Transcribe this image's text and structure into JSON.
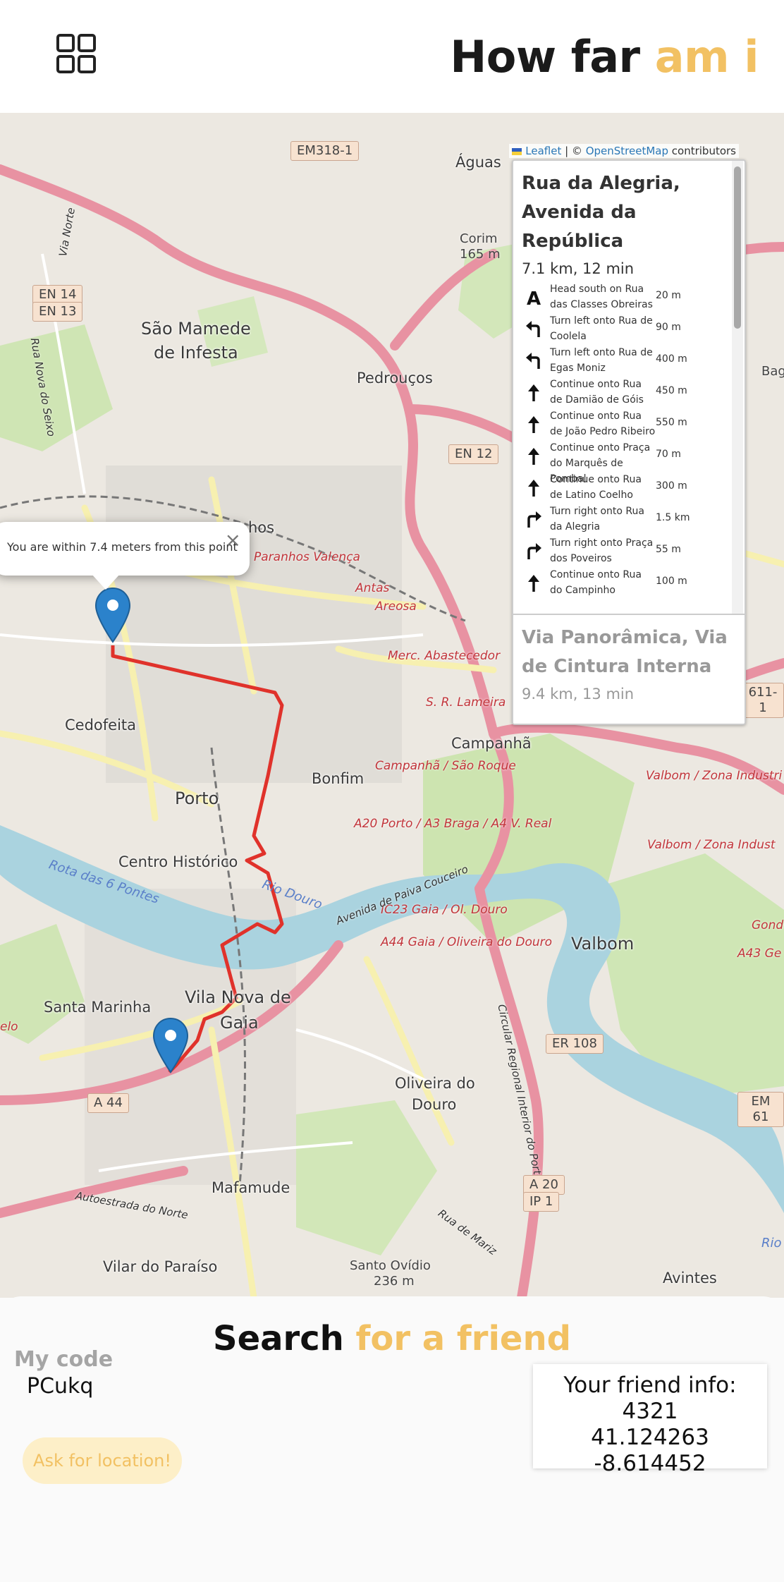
{
  "header": {
    "title_main": "How far ",
    "title_accent": "am i",
    "menu_icon": "grid-icon"
  },
  "map": {
    "attribution": {
      "leaflet": "Leaflet",
      "separator": " | © ",
      "osm": "OpenStreetMap",
      "contributors": " contributors"
    },
    "popup": {
      "text": "You are within 7.4 meters from this point",
      "close": "×"
    },
    "places": [
      "Águas",
      "São Mamede",
      "de Infesta",
      "Pedrouços",
      "Corim",
      "165 m",
      "Cedofeita",
      "Porto",
      "Bonfim",
      "Campanhã",
      "Centro Histórico",
      "Santa Marinha",
      "Vila Nova de",
      "Gaia",
      "Oliveira do",
      "Douro",
      "Valbom",
      "Mafamude",
      "Vilar do Paraíso",
      "Santo Ovídio",
      "236 m",
      "Avintes",
      "Paranhos",
      "hos",
      "Bag",
      "Valbom / Zona Industri",
      "Valbom / Zona Indust",
      "Gondom",
      "A43 Ge",
      "Rio",
      "elo"
    ],
    "road_labels": [
      "Paranhos Valença",
      "Antas",
      "Areosa",
      "Merc. Abastecedor",
      "S. R. Lameira",
      "Campanhã / São Roque",
      "A20 Porto / A3 Braga / A4 V. Real",
      "IC23 Gaia / Ol. Douro",
      "A44 Gaia / Oliveira do Douro",
      "Avenida de Paiva Couceiro",
      "Circular Regional Interior do Porto",
      "Autoestrada do Norte",
      "Rua de Mariz",
      "Via Norte",
      "Rua Nova do Seixo"
    ],
    "water_labels": [
      "Rota das 6 Pontes",
      "Rio Douro"
    ],
    "shields": [
      "EM318-1",
      "EN 14",
      "EN 13",
      "EN 12",
      "ER 108",
      "A 44",
      "A 20",
      "IP 1",
      "611-1",
      "EM 61"
    ]
  },
  "routing": {
    "active": {
      "title": "Rua da Alegria, Avenida da República",
      "summary": "7.1 km, 12 min",
      "steps": [
        {
          "icon": "depart-icon",
          "text": "Head south on Rua das Classes Obreiras",
          "distance": "20 m"
        },
        {
          "icon": "turn-left-icon",
          "text": "Turn left onto Rua de Coolela",
          "distance": "90 m"
        },
        {
          "icon": "turn-left-icon",
          "text": "Turn left onto Rua de Egas Moniz",
          "distance": "400 m"
        },
        {
          "icon": "straight-icon",
          "text": "Continue onto Rua de Damião de Góis",
          "distance": "450 m"
        },
        {
          "icon": "straight-icon",
          "text": "Continue onto Rua de João Pedro Ribeiro",
          "distance": "550 m"
        },
        {
          "icon": "straight-icon",
          "text": "Continue onto Praça do Marquês de Pombal",
          "distance": "70 m"
        },
        {
          "icon": "straight-icon",
          "text": "Continue onto Rua de Latino Coelho",
          "distance": "300 m"
        },
        {
          "icon": "turn-right-icon",
          "text": "Turn right onto Rua da Alegria",
          "distance": "1.5 km"
        },
        {
          "icon": "turn-right-icon",
          "text": "Turn right onto Praça dos Poveiros",
          "distance": "55 m"
        },
        {
          "icon": "straight-icon",
          "text": "Continue onto Rua do Campinho",
          "distance": "100 m"
        }
      ]
    },
    "alternative": {
      "title": "Via Panorâmica, Via de Cintura Interna",
      "summary": "9.4 km, 13 min"
    }
  },
  "search": {
    "title_main": "Search ",
    "title_accent": "for a friend",
    "my_code_label": "My code",
    "my_code_value": "PCukq",
    "ask_button": "Ask for location!",
    "friend_info_label": "Your friend info:",
    "friend_id": "4321",
    "friend_lat": "41.124263",
    "friend_lng": "-8.614452"
  },
  "colors": {
    "accent": "#f2c163",
    "route": "#e0322b",
    "marker": "#2b82cb"
  }
}
